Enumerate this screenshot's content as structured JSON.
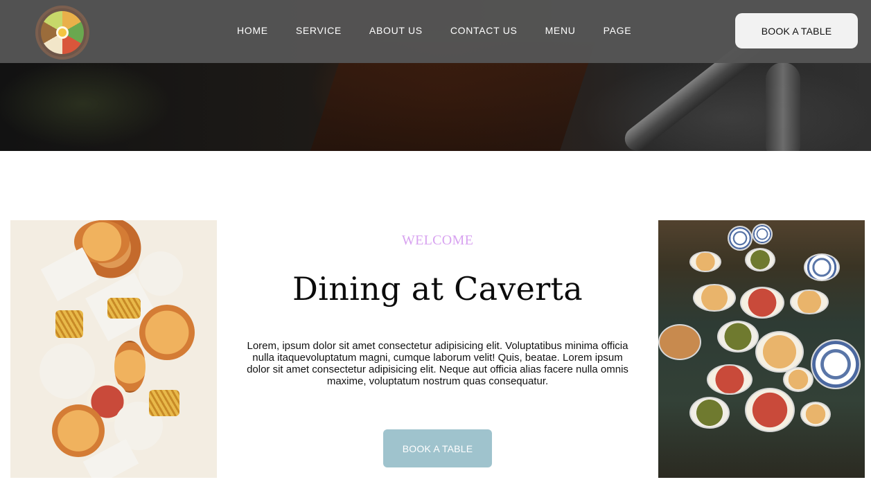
{
  "header": {
    "nav": [
      "HOME",
      "SERVICE",
      "ABOUT US",
      "CONTACT US",
      "MENU",
      "PAGE"
    ],
    "book_label": "BOOK A TABLE"
  },
  "welcome": {
    "eyebrow": "WELCOME",
    "title": "Dining at Caverta",
    "body": "Lorem, ipsum dolor sit amet consectetur adipisicing elit. Voluptatibus minima officia nulla itaquevoluptatum magni, cumque laborum velit! Quis, beatae. Lorem ipsum dolor sit amet consectetur adipisicing elit. Neque aut officia alias facere nulla omnis maxime, voluptatum nostrum quas consequatur.",
    "cta_label": "BOOK A TABLE"
  },
  "colors": {
    "header_bg": "#555555",
    "eyebrow": "#d8a3f0",
    "cta_bg": "#9fc3cd"
  }
}
